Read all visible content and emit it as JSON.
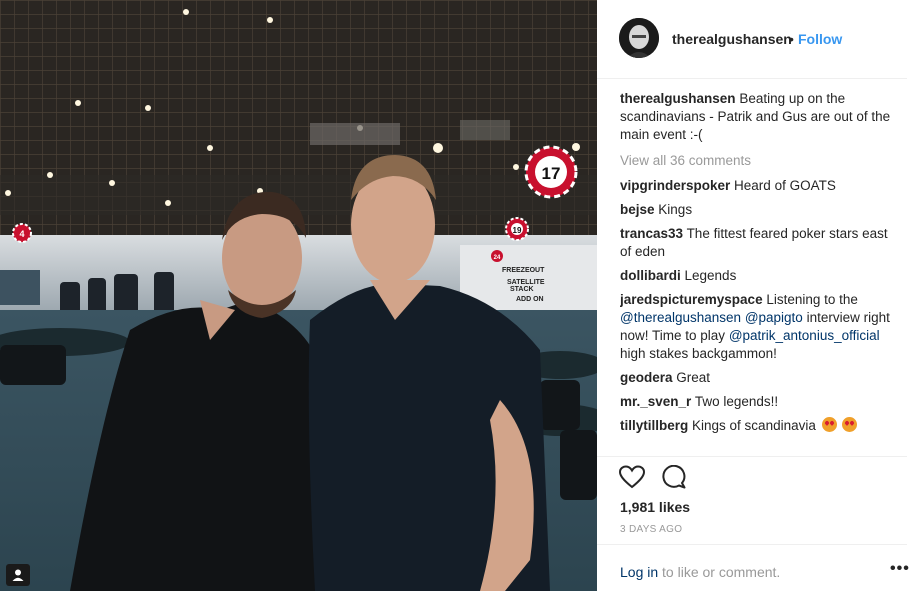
{
  "post": {
    "username": "therealgushansen",
    "separator": "•",
    "follow_label": "Follow",
    "caption": {
      "user": "therealgushansen",
      "text": "Beating up on the scandinavians - Patrik and Gus are out of the main event :-("
    },
    "view_all_label": "View all 36 comments",
    "comments": [
      {
        "user": "vipgrinderspoker",
        "text": "Heard of GOATS"
      },
      {
        "user": "bejse",
        "text": "Kings"
      },
      {
        "user": "trancas33",
        "text": "The fittest feared poker stars east of eden"
      },
      {
        "user": "dollibardi",
        "text": "Legends"
      },
      {
        "user": "jaredspicturemyspace",
        "text_a": "Listening to the",
        "mention_1": "@therealgushansen",
        "mention_2": "@papigto",
        "text_b": "interview right now! Time to play",
        "mention_3": "@patrik_antonius_official",
        "text_c": "high stakes backgammon!"
      },
      {
        "user": "geodera",
        "text": "Great"
      },
      {
        "user": "mr._sven_r",
        "text": "Two legends!!"
      },
      {
        "user": "tillytillberg",
        "text": "Kings of scandinavia",
        "emoji": "heart-eyes-emoji"
      }
    ],
    "likes": "1,981 likes",
    "age": "3 DAYS AGO",
    "login_link": "Log in",
    "login_rest": "to like or comment.",
    "more_label": "•••"
  },
  "photo": {
    "signs": [
      "17",
      "4",
      "19",
      "24"
    ],
    "board_lines": [
      "FREEZEOUT",
      "SATELLITE",
      "STACK",
      "ADD ON"
    ],
    "icons": [
      "user-tag-icon",
      "heart-icon",
      "comment-icon",
      "more-options-icon"
    ]
  },
  "colors": {
    "link": "#3897f0",
    "mention": "#003569",
    "muted": "#999999",
    "text": "#262626"
  }
}
